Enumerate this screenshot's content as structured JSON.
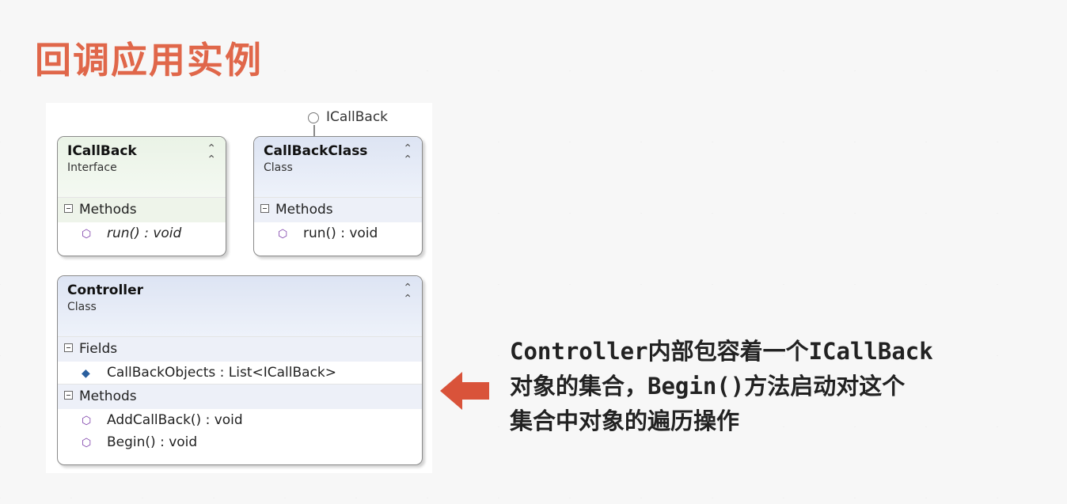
{
  "slide": {
    "title": "回调应用实例"
  },
  "diagram": {
    "interface_lollipop": "ICallBack",
    "classes": [
      {
        "name": "ICallBack",
        "kind": "Interface",
        "sections": [
          {
            "label": "Methods",
            "members": [
              "run() : void"
            ]
          }
        ]
      },
      {
        "name": "CallBackClass",
        "kind": "Class",
        "sections": [
          {
            "label": "Methods",
            "members": [
              "run() : void"
            ]
          }
        ]
      },
      {
        "name": "Controller",
        "kind": "Class",
        "sections": [
          {
            "label": "Fields",
            "members": [
              "CallBackObjects : List<ICallBack>"
            ]
          },
          {
            "label": "Methods",
            "members": [
              "AddCallBack() : void",
              "Begin() : void"
            ]
          }
        ]
      }
    ]
  },
  "caption": {
    "lines": [
      "Controller内部包容着一个ICallBack",
      "对象的集合，Begin()方法启动对这个",
      "集合中对象的遍历操作"
    ]
  },
  "colors": {
    "title": "#e0674a",
    "arrow": "#d9533a",
    "interface_header": "#eaf3e6",
    "class_header": "#dde4f3"
  }
}
